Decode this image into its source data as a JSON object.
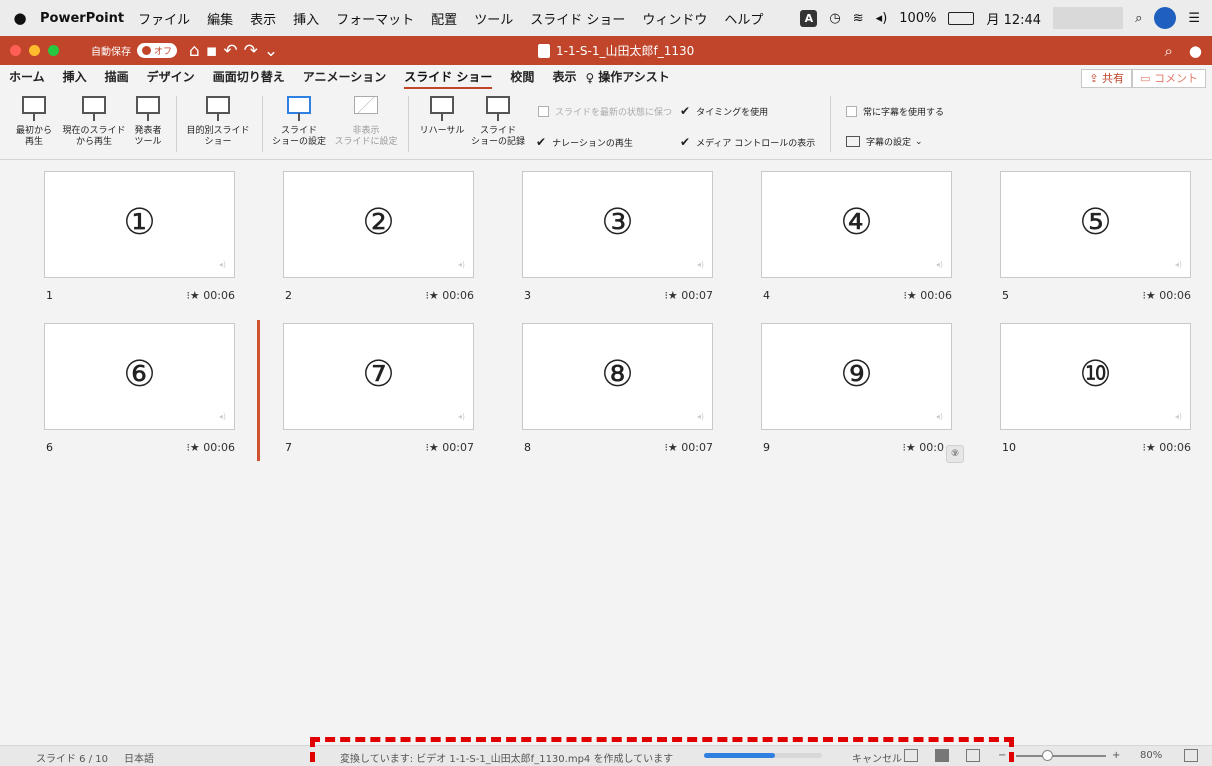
{
  "menubar": {
    "app_name": "PowerPoint",
    "items": [
      "ファイル",
      "編集",
      "表示",
      "挿入",
      "フォーマット",
      "配置",
      "ツール",
      "スライド ショー",
      "ウィンドウ",
      "ヘルプ"
    ],
    "input_badge": "A",
    "battery_text": "100%",
    "battery_label": "",
    "clock": "月 12:44"
  },
  "titlebar": {
    "autosave_label": "自動保存",
    "autosave_state": "オフ",
    "document_title": "1-1-S-1_山田太郎f_1130",
    "accent_color": "#c0452a"
  },
  "ribbon_tabs": {
    "tabs": [
      "ホーム",
      "挿入",
      "描画",
      "デザイン",
      "画面切り替え",
      "アニメーション",
      "スライド ショー",
      "校閲",
      "表示",
      "操作アシスト"
    ],
    "active": "スライド ショー",
    "share_label": "共有",
    "comment_label": "コメント"
  },
  "ribbon": {
    "from_start": [
      "最初から",
      "再生"
    ],
    "from_current": [
      "現在のスライド",
      "から再生"
    ],
    "presenter": [
      "発表者",
      "ツール"
    ],
    "custom_show": [
      "目的別スライド",
      "ショー"
    ],
    "setup_show": [
      "スライド",
      "ショーの設定"
    ],
    "hide_slide": [
      "非表示",
      "スライドに設定"
    ],
    "rehearse": "リハーサル",
    "record": [
      "スライド",
      "ショーの記録"
    ],
    "keep_updated": "スライドを最新の状態に保つ",
    "use_timings": "タイミングを使用",
    "play_narrations": "ナレーションの再生",
    "show_media_controls": "メディア コントロールの表示",
    "always_subtitles": "常に字幕を使用する",
    "subtitle_settings": "字幕の設定"
  },
  "slides": [
    {
      "label": "①",
      "index": "1",
      "time": "00:06"
    },
    {
      "label": "②",
      "index": "2",
      "time": "00:06"
    },
    {
      "label": "③",
      "index": "3",
      "time": "00:07"
    },
    {
      "label": "④",
      "index": "4",
      "time": "00:06"
    },
    {
      "label": "⑤",
      "index": "5",
      "time": "00:06"
    },
    {
      "label": "⑥",
      "index": "6",
      "time": "00:06"
    },
    {
      "label": "⑦",
      "index": "7",
      "time": "00:07"
    },
    {
      "label": "⑧",
      "index": "8",
      "time": "00:07"
    },
    {
      "label": "⑨",
      "index": "9",
      "time": "00:0"
    },
    {
      "label": "⑩",
      "index": "10",
      "time": "00:06"
    }
  ],
  "tooltip_text": "⑨",
  "statusbar": {
    "slide_indicator": "スライド 6 / 10",
    "language": "日本語",
    "export_status": "変換しています: ビデオ 1-1-S-1_山田太郎f_1130.mp4 を作成しています",
    "export_progress": 0.6,
    "cancel_label": "キャンセル",
    "zoom_minus": "−",
    "zoom_plus": "+",
    "zoom_level": "80%"
  }
}
